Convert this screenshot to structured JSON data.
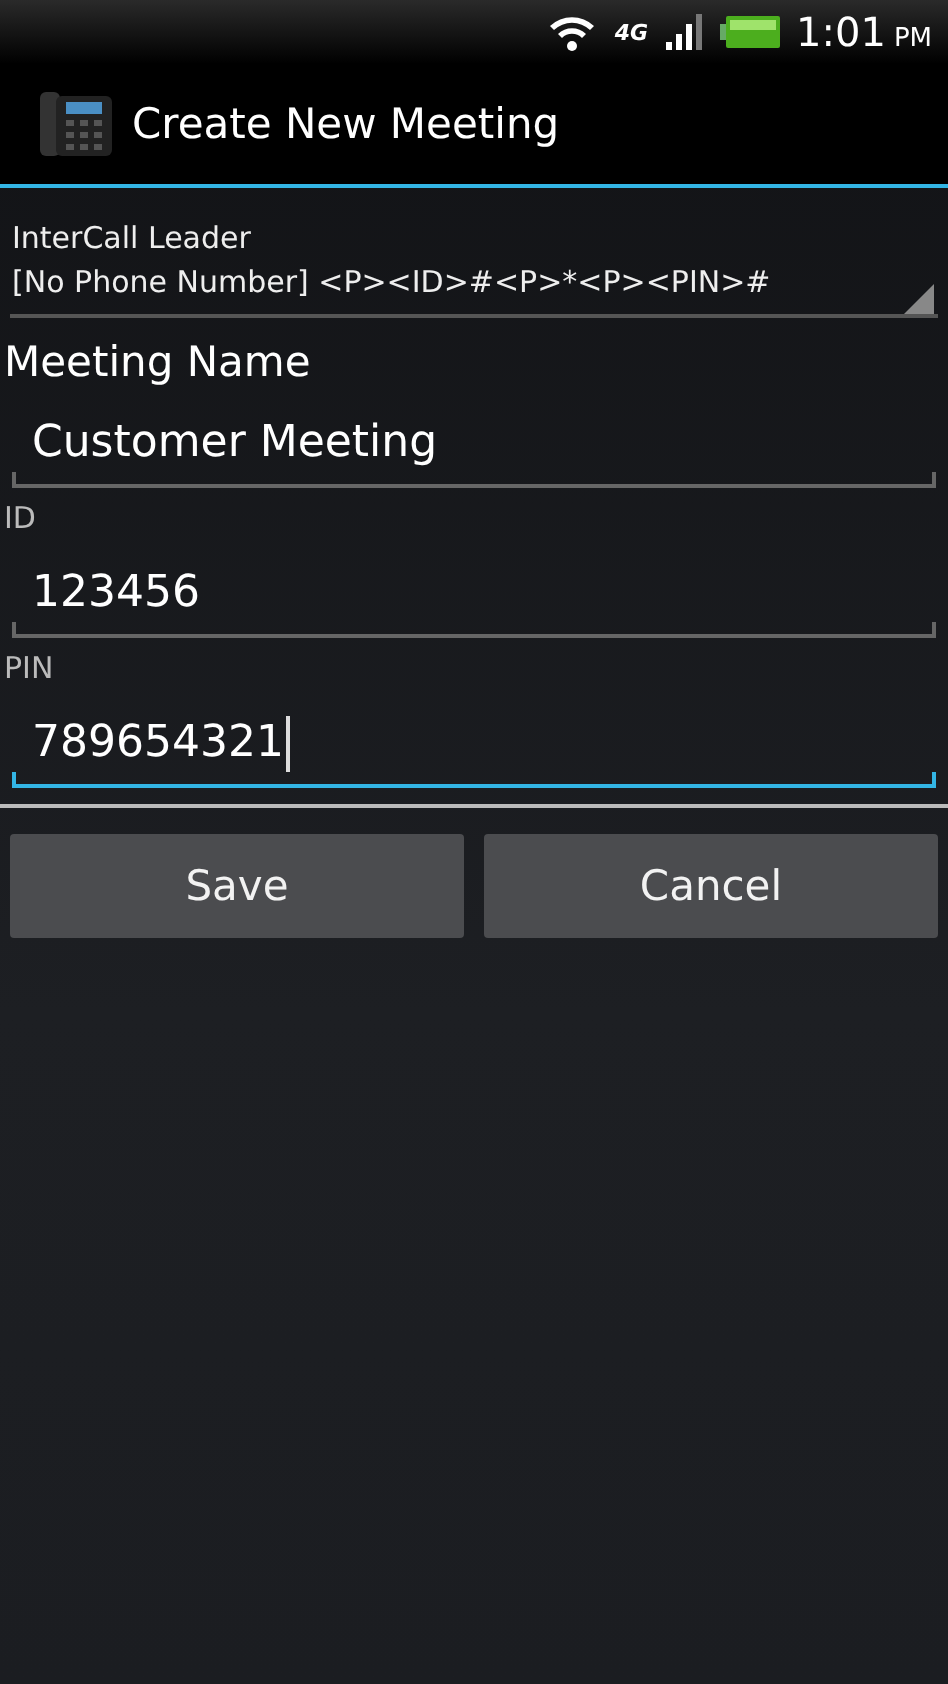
{
  "status_bar": {
    "network": "4G",
    "time": "1:01",
    "time_suffix": "PM"
  },
  "action_bar": {
    "title": "Create New Meeting"
  },
  "spinner": {
    "title": "InterCall Leader",
    "value": "[No Phone Number] <P><ID>#<P>*<P><PIN>#"
  },
  "fields": [
    {
      "label": "Meeting Name",
      "kind": "heading",
      "value": "Customer Meeting",
      "focused": false
    },
    {
      "label": "ID",
      "kind": "caption",
      "value": "123456",
      "focused": false
    },
    {
      "label": "PIN",
      "kind": "caption",
      "value": "789654321",
      "focused": true
    }
  ],
  "buttons": [
    "Save",
    "Cancel"
  ]
}
